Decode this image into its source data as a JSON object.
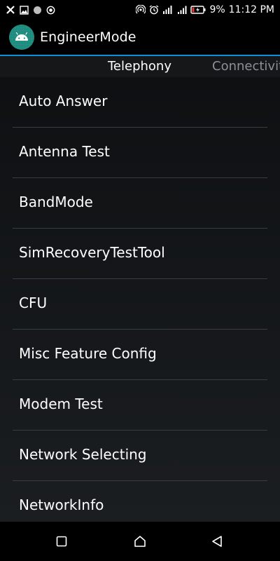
{
  "status_bar": {
    "icons_left": [
      "close-x-icon",
      "image-icon",
      "circle-icon",
      "target-icon"
    ],
    "icons_right": [
      "hotspot-icon",
      "alarm-icon",
      "signal-icon",
      "wifi-signal-icon",
      "battery-charging-icon"
    ],
    "battery": "9%",
    "time": "11:12 PM"
  },
  "app_bar": {
    "title": "EngineerMode",
    "icon": "android-icon",
    "accent_color": "#0e8fd6",
    "icon_bg_color": "#1f8a7d"
  },
  "tabs": [
    {
      "label": "Telephony",
      "active": true
    },
    {
      "label": "Connectivity",
      "active": false
    }
  ],
  "list": {
    "items": [
      {
        "label": "Auto Answer"
      },
      {
        "label": "Antenna Test"
      },
      {
        "label": "BandMode"
      },
      {
        "label": "SimRecoveryTestTool"
      },
      {
        "label": "CFU"
      },
      {
        "label": "Misc Feature Config"
      },
      {
        "label": "Modem Test"
      },
      {
        "label": "Network Selecting"
      },
      {
        "label": "NetworkInfo"
      }
    ]
  },
  "nav_bar": {
    "buttons": [
      "recents-icon",
      "home-icon",
      "back-icon"
    ]
  }
}
